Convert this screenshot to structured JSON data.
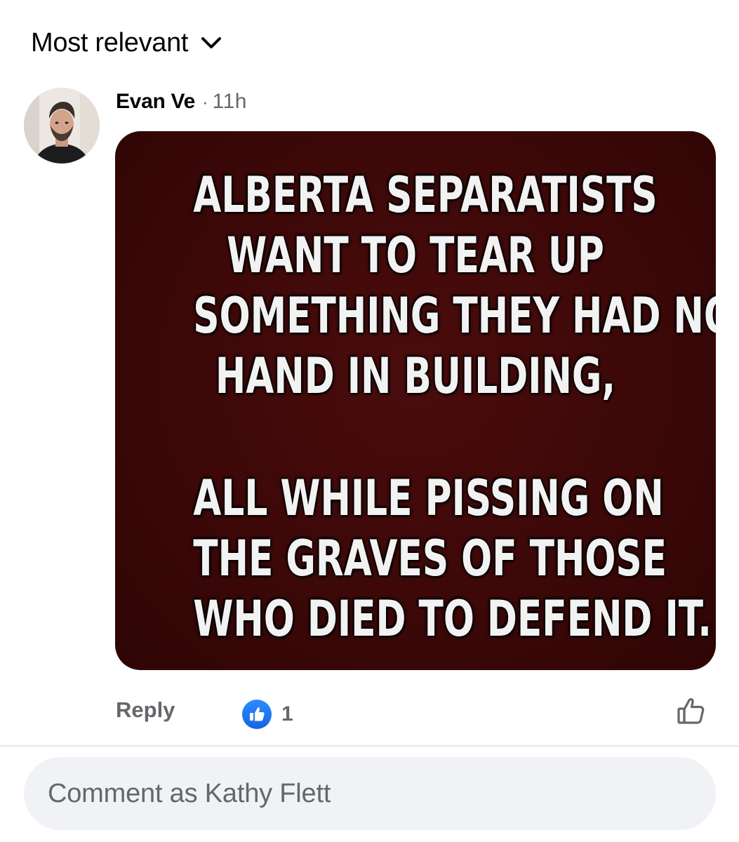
{
  "sort": {
    "label": "Most relevant"
  },
  "comment": {
    "author": "Evan Ve",
    "separator": "·",
    "time": "11h",
    "image_text": {
      "block1": [
        "ALBERTA SEPARATISTS",
        "WANT TO TEAR UP",
        "SOMETHING THEY HAD NO",
        "HAND IN BUILDING,"
      ],
      "block2": [
        "ALL WHILE PISSING ON",
        "THE GRAVES OF THOSE",
        "WHO DIED TO DEFEND IT."
      ]
    },
    "reply_label": "Reply",
    "reaction_count": "1"
  },
  "composer": {
    "placeholder": "Comment as Kathy Flett"
  },
  "colors": {
    "meme_background": "#3d0808",
    "reaction_blue": "#1877f2",
    "secondary_text": "#65676b",
    "composer_bg": "#f0f2f5"
  },
  "icons": {
    "sort": "chevron-down-icon",
    "reaction": "thumbs-up-filled-icon",
    "like": "thumbs-up-outline-icon"
  }
}
